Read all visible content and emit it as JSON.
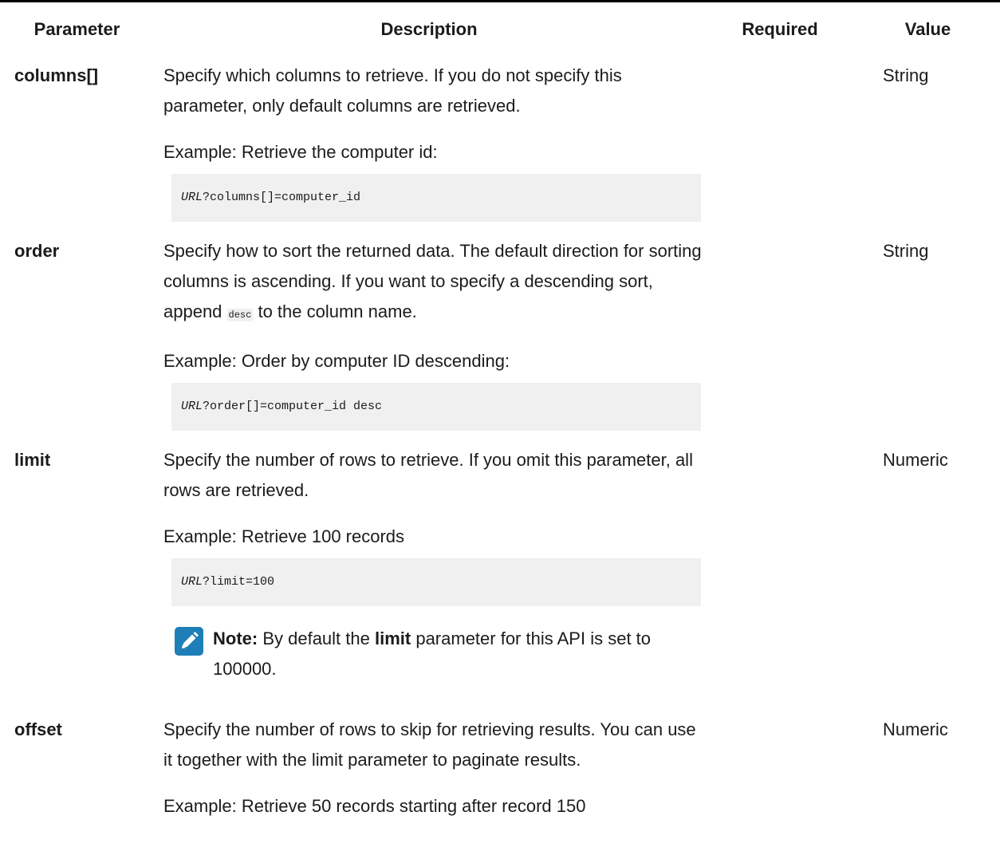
{
  "table": {
    "headers": {
      "parameter": "Parameter",
      "description": "Description",
      "required": "Required",
      "value": "Value"
    },
    "rows": [
      {
        "name": "columns[]",
        "description": "Specify which columns to retrieve. If you do not specify this parameter, only default columns are retrieved.",
        "example_label": "Example: Retrieve the computer id:",
        "code_var": "URL",
        "code_rest": "?columns[]=computer_id",
        "required": "",
        "value": "String"
      },
      {
        "name": "order",
        "description_before": "Specify how to sort the returned data. The default direction for sorting columns is ascending. If you want to specify a descending sort, append ",
        "description_code": "desc",
        "description_after": " to the column name.",
        "example_label": "Example: Order by computer ID descending:",
        "code_var": "URL",
        "code_rest": "?order[]=computer_id desc",
        "required": "",
        "value": "String"
      },
      {
        "name": "limit",
        "description": "Specify the number of rows to retrieve. If you omit this parameter, all rows are retrieved.",
        "example_label": "Example: Retrieve 100 records",
        "code_var": "URL",
        "code_rest": "?limit=100",
        "note_label": "Note:",
        "note_before": " By default the ",
        "note_bold": "limit",
        "note_after": " parameter for this API is set to 100000.",
        "note_icon": "pencil-note-icon",
        "required": "",
        "value": "Numeric"
      },
      {
        "name": "offset",
        "description": "Specify the number of rows to skip for retrieving results. You can use it together with the limit parameter to paginate results.",
        "example_label": "Example: Retrieve 50 records starting after record 150",
        "required": "",
        "value": "Numeric"
      }
    ]
  },
  "colors": {
    "note_icon_bg": "#1e7fb8",
    "code_bg": "#f0f0f0",
    "rule": "#000000"
  }
}
